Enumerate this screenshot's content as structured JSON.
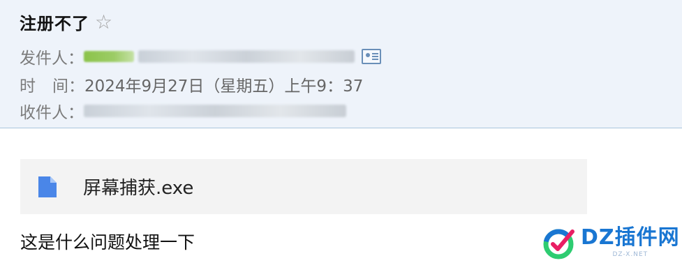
{
  "email": {
    "subject": "注册不了",
    "star_icon": "star-outline-icon",
    "from_label": "发件人：",
    "time_label_a": "时",
    "time_label_b": "间：",
    "time_value": "2024年9月27日（星期五）上午9：37",
    "to_label": "收件人：",
    "contact_icon": "contact-card-icon"
  },
  "attachment": {
    "icon": "file-icon",
    "filename": "屏幕捕获.exe"
  },
  "body": {
    "text": "这是什么问题处理一下"
  },
  "watermark": {
    "text": "DZ插件网",
    "sub": "DZ-X.NET"
  },
  "colors": {
    "header_bg": "#eef3fa",
    "header_border": "#a9c4dc",
    "attachment_bg": "#f3f3f3",
    "file_icon": "#4a86e8",
    "watermark_blue": "#1976d2"
  }
}
